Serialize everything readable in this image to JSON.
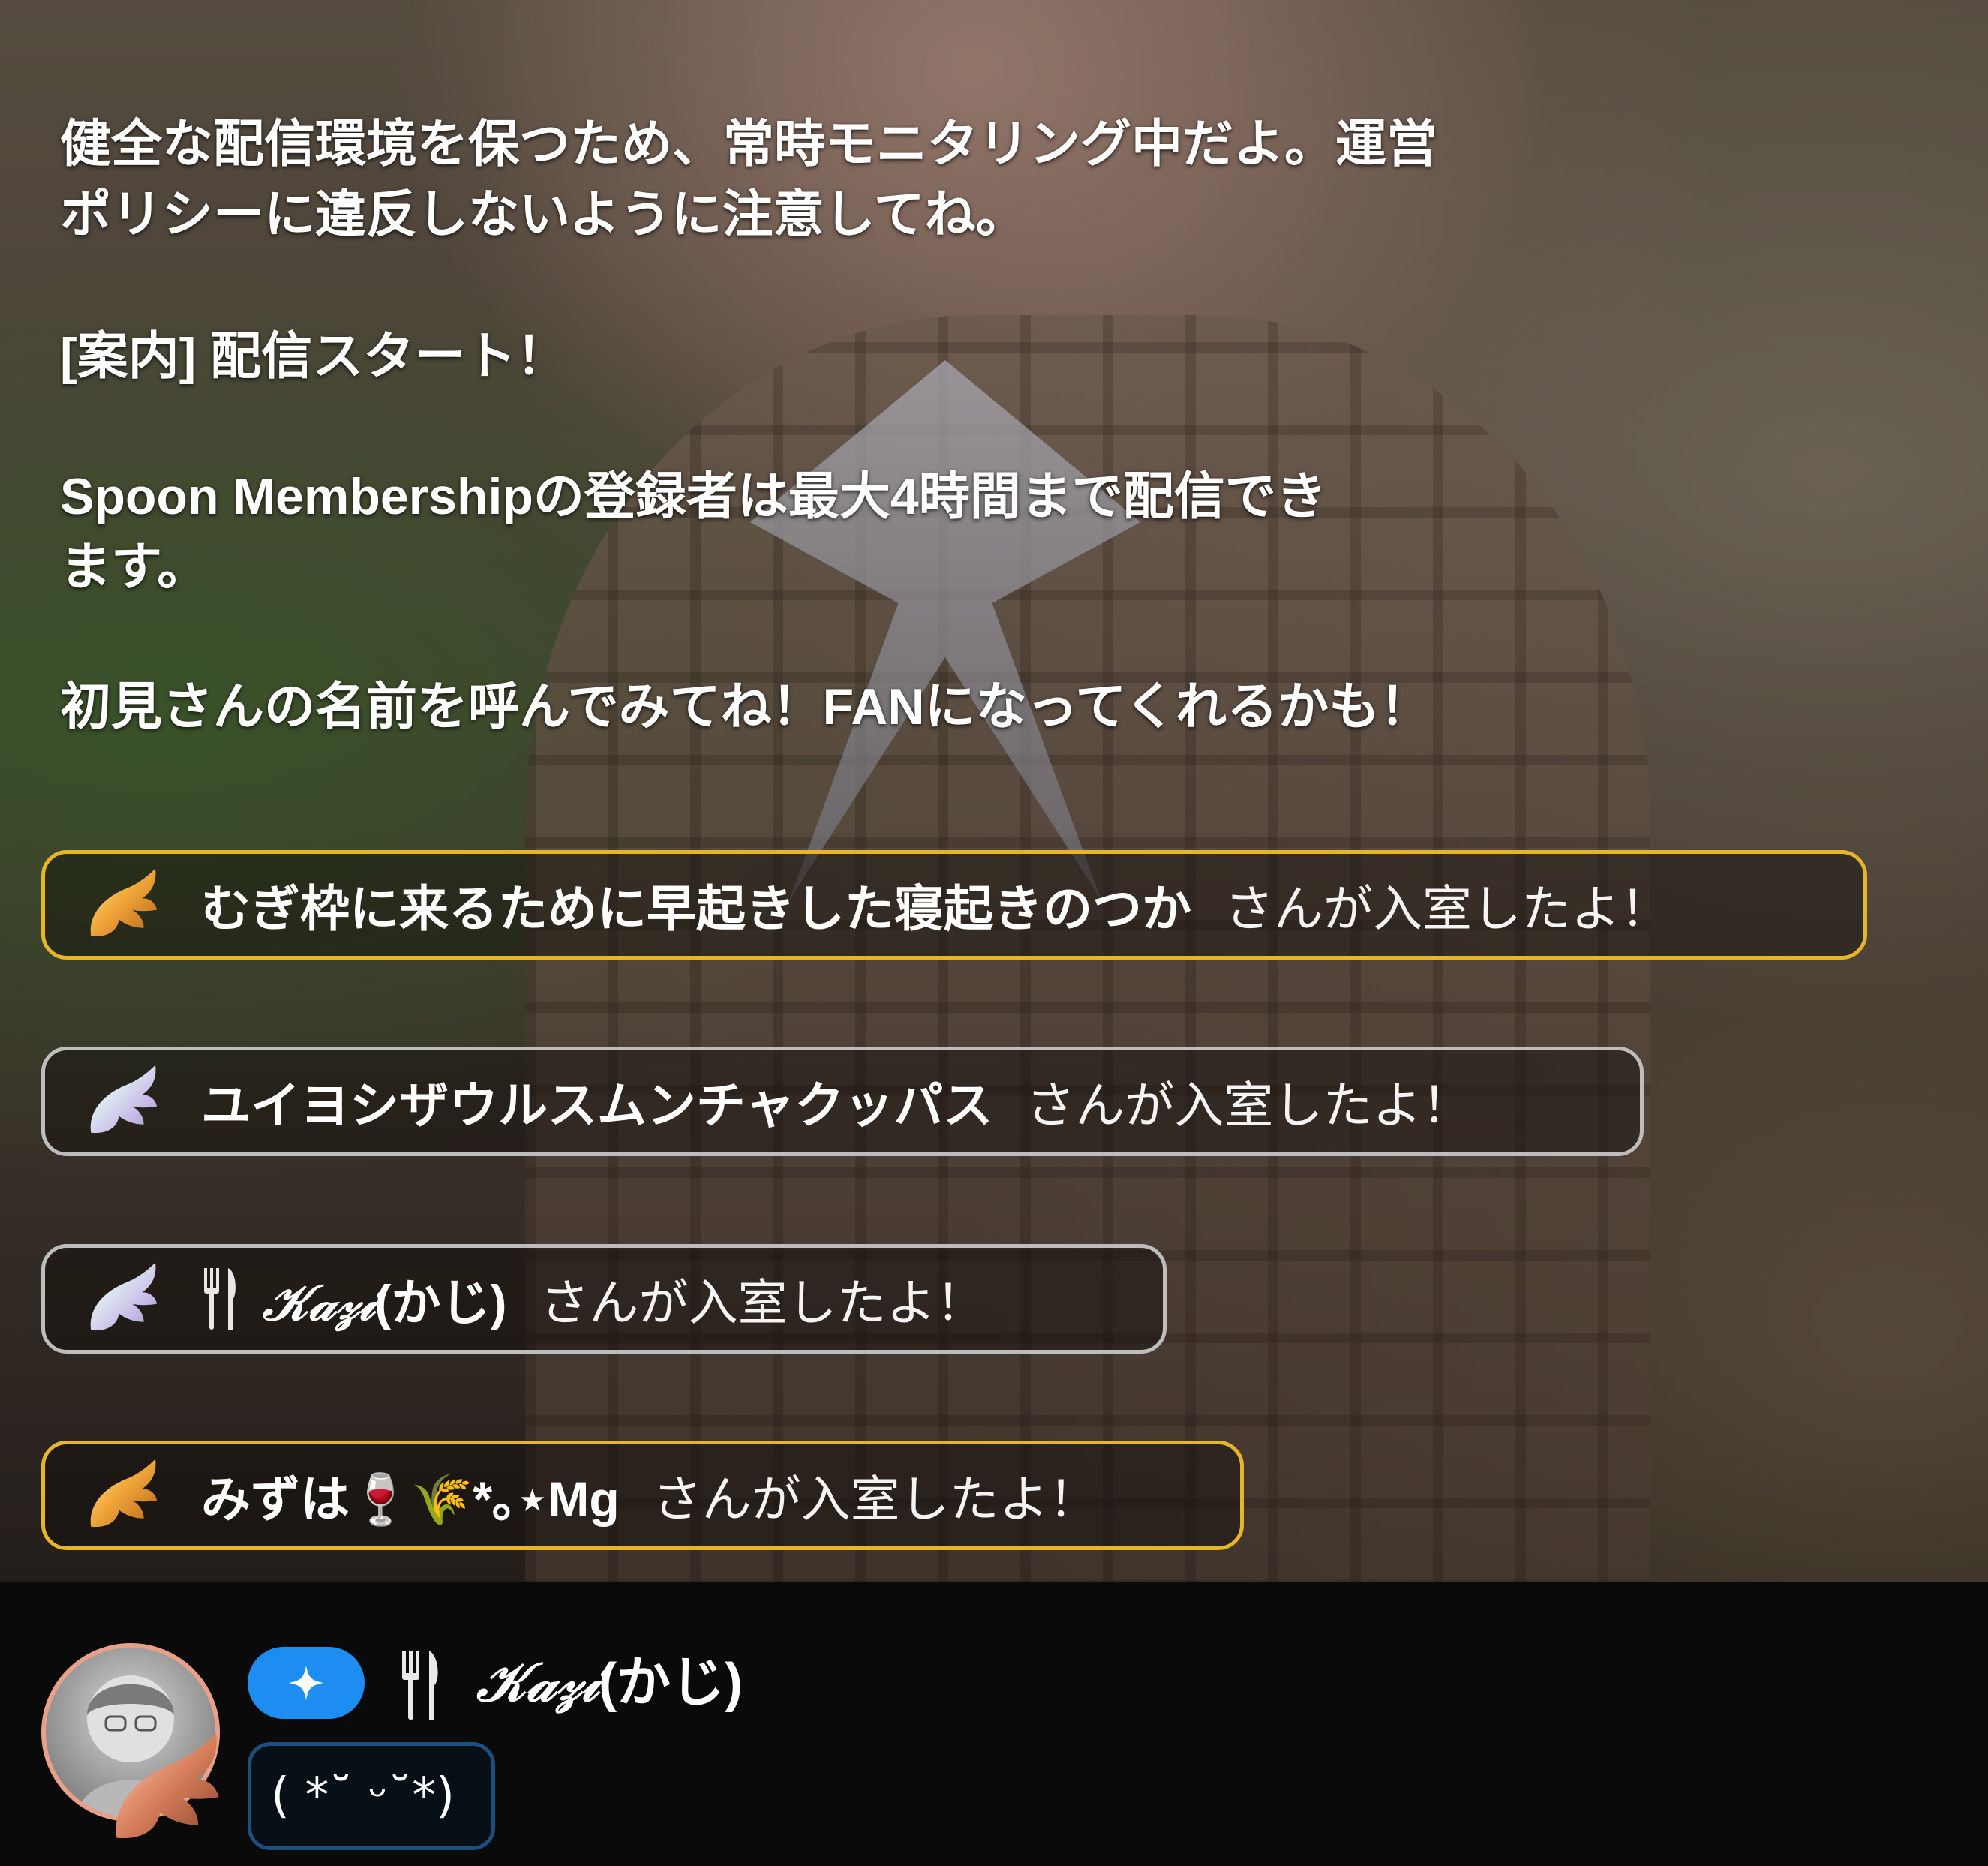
{
  "notices": [
    "健全な配信環境を保つため、常時モニタリング中だよ。運営\nポリシーに違反しないように注意してね。",
    "[案内] 配信スタート！",
    "Spoon Membershipの登録者は最大4時間まで配信でき\nます。",
    "初見さんの名前を呼んでみてね！FANになってくれるかも！"
  ],
  "join_suffix": "さんが入室したよ！",
  "joins": [
    {
      "tier": "gold",
      "icon": "gold-wing-icon",
      "name": "むぎ枠に来るために早起きした寝起きのつか"
    },
    {
      "tier": "silver",
      "icon": "silver-wing-icon",
      "name": "ユイヨシザウルスムンチャクッパス"
    },
    {
      "tier": "silver",
      "icon": "silver-wing-icon",
      "prefix_icon": "fork-knife-icon",
      "name_styled": "𝒦𝒶𝓏𝒾",
      "name_rest": "(かじ)"
    },
    {
      "tier": "gold",
      "icon": "gold-wing-icon",
      "name": "みずは🍷🌾*｡⋆Mg"
    }
  ],
  "current_user": {
    "badge_icon": "plus-badge-icon",
    "prefix_icon": "fork-knife-icon",
    "name_styled": "𝒦𝒶𝓏𝒾",
    "name_rest": "(かじ)",
    "message": "( *˘ ᵕ˘*)"
  },
  "colors": {
    "gold_border": "#e6b52a",
    "silver_border": "#bdbdbd",
    "badge_blue": "#1d8df2",
    "message_border": "#1b4f7e",
    "avatar_ring": "#e8a088"
  }
}
